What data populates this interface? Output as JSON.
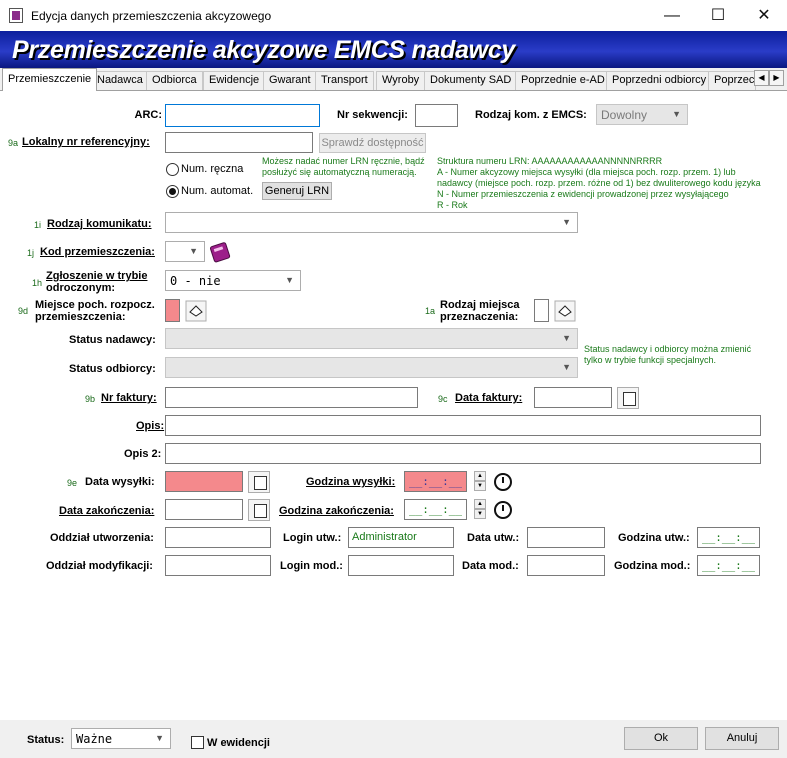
{
  "window": {
    "title": "Edycja danych przemieszczenia akcyzowego",
    "minimize": "—",
    "maximize": "☐",
    "close": "✕"
  },
  "banner": {
    "title": "Przemieszczenie akcyzowe EMCS nadawcy"
  },
  "tabs": [
    "Przemieszczenie",
    "Nadawca",
    "Odbiorca",
    "Ewidencje",
    "Gwarant",
    "Transport",
    "Wyroby",
    "Dokumenty SAD",
    "Poprzednie e-AD",
    "Poprzedni odbiorcy",
    "Poprzec"
  ],
  "tab_arrows": {
    "left": "◀",
    "right": "▶"
  },
  "form": {
    "arc_label": "ARC:",
    "nr_sekwencji_label": "Nr sekwencji:",
    "rodzaj_kom_label": "Rodzaj kom. z  EMCS:",
    "rodzaj_kom_value": "Dowolny",
    "lrn_num": "9a",
    "lrn_label": "Lokalny nr referencyjny:",
    "sprawdz_button": "Sprawdź dostępność",
    "radio_manual": "Num. ręczna",
    "radio_auto": "Num. automat.",
    "generuj_button": "Generuj LRN",
    "lrn_hint": "Możesz nadać numer LRN ręcznie, bądź posłużyć się automatyczną numeracją.",
    "lrn_structure": [
      "Struktura numeru LRN: AAAAAAAAAAAANNNNNRRRR",
      "A - Numer akcyzowy miejsca wysyłki (dla miejsca poch. rozp. przem. 1) lub",
      "nadawcy (miejsce poch. rozp. przem. różne od 1) bez dwuliterowego kodu języka",
      "N - Numer przemieszczenia z ewidencji prowadzonej przez wysyłającego",
      "R - Rok"
    ],
    "rodzaj_komunikatu_num": "1i",
    "rodzaj_komunikatu_label": "Rodzaj komunikatu:",
    "kod_przem_num": "1j",
    "kod_przem_label": "Kod przemieszczenia:",
    "zgloszenie_num": "1h",
    "zgloszenie_label_1": "Zgłoszenie w trybie",
    "zgloszenie_label_2": "odroczonym:",
    "zgloszenie_value": "0 - nie",
    "miejsce_num": "9d",
    "miejsce_label_1": "Miejsce poch. rozpocz.",
    "miejsce_label_2": "przemieszczenia:",
    "rodzaj_miejsca_num": "1a",
    "rodzaj_miejsca_label_1": "Rodzaj miejsca",
    "rodzaj_miejsca_label_2": "przeznaczenia:",
    "status_nadawcy_label": "Status nadawcy:",
    "status_odbiorcy_label": "Status odbiorcy:",
    "status_hint": "Status nadawcy i odbiorcy można zmienić tylko w trybie funkcji specjalnych.",
    "nr_faktury_num": "9b",
    "nr_faktury_label": "Nr faktury:",
    "data_faktury_num": "9c",
    "data_faktury_label": "Data faktury:",
    "opis_label": "Opis:",
    "opis2_label": "Opis 2:",
    "data_wysylki_num": "9e",
    "data_wysylki_label": "Data wysyłki:",
    "godzina_wysylki_label": "Godzina wysyłki:",
    "godzina_wysylki_value": "__:__:__",
    "data_zakonczenia_label": "Data zakończenia:",
    "godzina_zakonczenia_label": "Godzina zakończenia:",
    "godzina_zakonczenia_value": "__:__:__",
    "oddzial_utw_label": "Oddział utworzenia:",
    "login_utw_label": "Login utw.:",
    "login_utw_value": "Administrator",
    "data_utw_label": "Data utw.:",
    "godzina_utw_label": "Godzina utw.:",
    "godzina_utw_value": "__:__:__",
    "oddzial_mod_label": "Oddział modyfikacji:",
    "login_mod_label": "Login mod.:",
    "data_mod_label": "Data mod.:",
    "godzina_mod_label": "Godzina mod.:",
    "godzina_mod_value": "__:__:__"
  },
  "footer": {
    "status_label": "Status:",
    "status_value": "Ważne",
    "w_ewidencji_label": "W ewidencji",
    "ok_button": "Ok",
    "anuluj_button": "Anuluj"
  },
  "colors": {
    "banner": "#1a2db5",
    "required_field": "#f4898c",
    "hint_text": "#1a7a1a"
  }
}
